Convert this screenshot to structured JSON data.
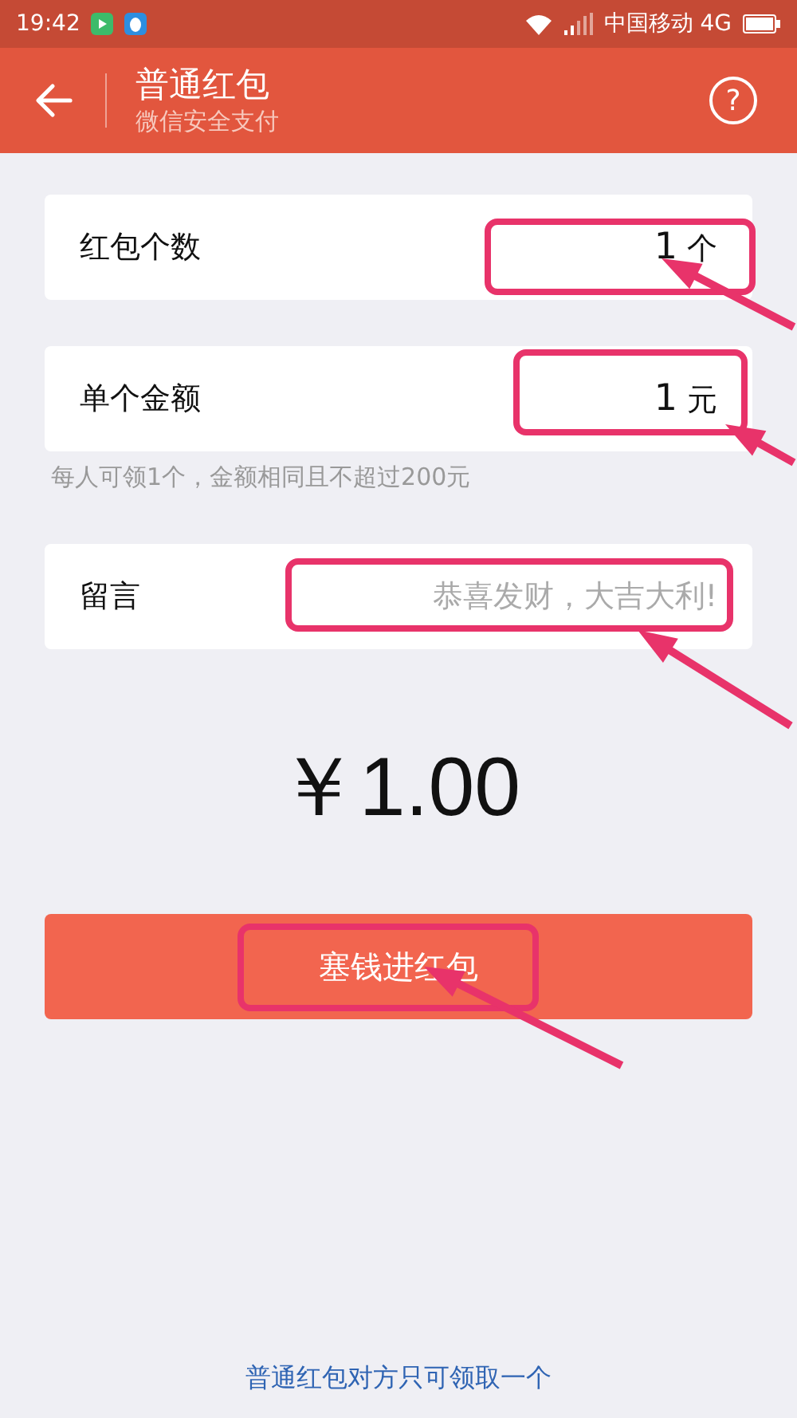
{
  "status_bar": {
    "time": "19:42",
    "carrier": "中国移动 4G"
  },
  "header": {
    "title": "普通红包",
    "subtitle": "微信安全支付",
    "help": "?"
  },
  "fields": [
    {
      "kind": "number",
      "label": "红包个数",
      "value": "1",
      "unit": "个"
    },
    {
      "kind": "number",
      "label": "单个金额",
      "value": "1",
      "unit": "元"
    },
    {
      "kind": "text",
      "label": "留言",
      "placeholder": "恭喜发财，大吉大利!"
    }
  ],
  "hint": "每人可领1个，金额相同且不超过200元",
  "amount": "￥1.00",
  "submit_button": "塞钱进红包",
  "footer_link": "普通红包对方只可领取一个"
}
